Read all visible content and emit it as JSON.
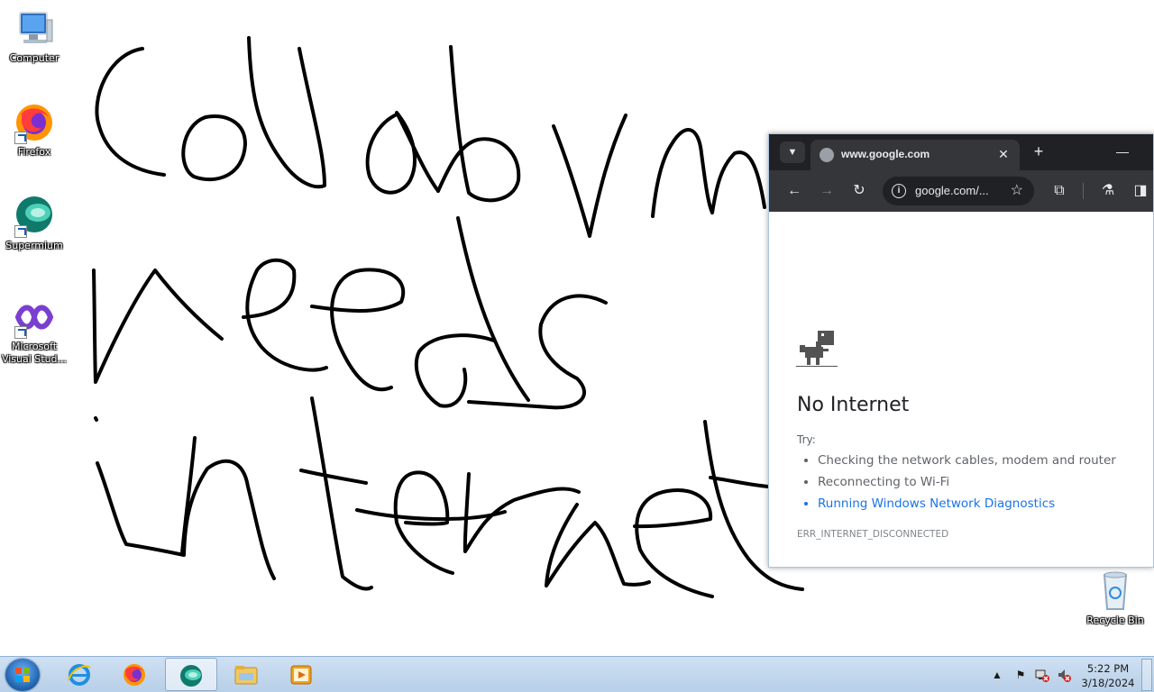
{
  "desktop": {
    "icons": [
      {
        "label": "Computer",
        "icon": "computer-icon"
      },
      {
        "label": "Firefox",
        "icon": "firefox-icon"
      },
      {
        "label": "Supermium",
        "icon": "supermium-icon"
      },
      {
        "label": "Microsoft Visual Stud...",
        "icon": "visual-studio-icon"
      },
      {
        "label": "Recycle Bin",
        "icon": "recycle-bin-icon"
      }
    ]
  },
  "browser": {
    "tab_title": "www.google.com",
    "tab_close": "✕",
    "new_tab": "+",
    "minimize": "—",
    "url": "google.com/...",
    "page": {
      "title": "No Internet",
      "try_label": "Try:",
      "suggestions": [
        "Checking the network cables, modem and router",
        "Reconnecting to Wi-Fi",
        "Running Windows Network Diagnostics"
      ],
      "error_code": "ERR_INTERNET_DISCONNECTED"
    }
  },
  "taskbar": {
    "apps": [
      "internet-explorer-icon",
      "firefox-icon",
      "supermium-icon",
      "file-explorer-icon",
      "media-player-icon"
    ],
    "clock_time": "5:22 PM",
    "clock_date": "3/18/2024"
  },
  "colors": {
    "link": "#1a73e8",
    "tab_strip": "#202124",
    "toolbar": "#35363a",
    "taskbar": "#b7cfe8"
  }
}
